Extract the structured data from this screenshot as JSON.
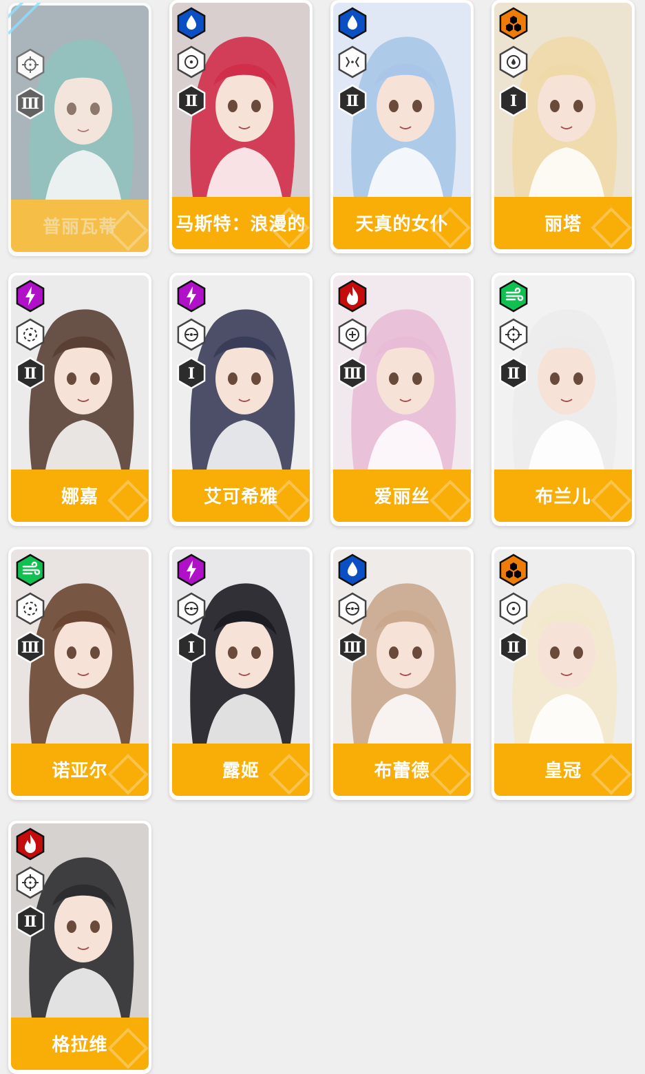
{
  "characters": [
    {
      "name": "普丽瓦蒂",
      "element": "none",
      "weapon": "crosshair",
      "class": "Ⅲ",
      "bg": "#8fa0a8",
      "hair": "#6fb0ac",
      "dimmed": true
    },
    {
      "name": "马斯特：浪漫的",
      "element": "water",
      "weapon": "circle-dot",
      "class": "Ⅱ",
      "bg": "#d9cfcf",
      "hair": "#d02e4a"
    },
    {
      "name": "天真的女仆",
      "element": "water",
      "weapon": "bracket",
      "class": "Ⅱ",
      "bg": "#dfe8f4",
      "hair": "#a9c6e8"
    },
    {
      "name": "丽塔",
      "element": "iron",
      "weapon": "droplet-circle",
      "class": "Ⅰ",
      "bg": "#ece3d0",
      "hair": "#f0d9a8"
    },
    {
      "name": "娜嘉",
      "element": "electric",
      "weapon": "dotted-circle",
      "class": "Ⅱ",
      "bg": "#ebebeb",
      "hair": "#5a4034"
    },
    {
      "name": "艾可希雅",
      "element": "electric",
      "weapon": "scope",
      "class": "Ⅰ",
      "bg": "#eeeeee",
      "hair": "#3a3d58"
    },
    {
      "name": "爱丽丝",
      "element": "fire",
      "weapon": "scope-plus",
      "class": "Ⅲ",
      "bg": "#f1e9ee",
      "hair": "#e8bcd6"
    },
    {
      "name": "布兰儿",
      "element": "wind",
      "weapon": "crosshair",
      "class": "Ⅱ",
      "bg": "#f2f2f2",
      "hair": "#ececec"
    },
    {
      "name": "诺亚尔",
      "element": "wind",
      "weapon": "dotted-circle",
      "class": "Ⅲ",
      "bg": "#e9e4e1",
      "hair": "#6a4632"
    },
    {
      "name": "露姬",
      "element": "electric",
      "weapon": "scope",
      "class": "Ⅰ",
      "bg": "#e8e8ea",
      "hair": "#1c1c22"
    },
    {
      "name": "布蕾德",
      "element": "water",
      "weapon": "scope",
      "class": "Ⅲ",
      "bg": "#efebe8",
      "hair": "#c9a88e"
    },
    {
      "name": "皇冠",
      "element": "iron",
      "weapon": "circle-dot",
      "class": "Ⅱ",
      "bg": "#eeeeee",
      "hair": "#f2e8cc"
    },
    {
      "name": "格拉维",
      "element": "fire",
      "weapon": "crosshair",
      "class": "Ⅱ",
      "bg": "#d5d2cf",
      "hair": "#2d2d30"
    }
  ],
  "colors": {
    "accent": "#f8ad07",
    "water": "#0a4fc4",
    "electric": "#b010c8",
    "fire": "#c40c0c",
    "wind": "#10c050",
    "iron": "#f07c08",
    "hex_dark": "#2c2c2c"
  }
}
